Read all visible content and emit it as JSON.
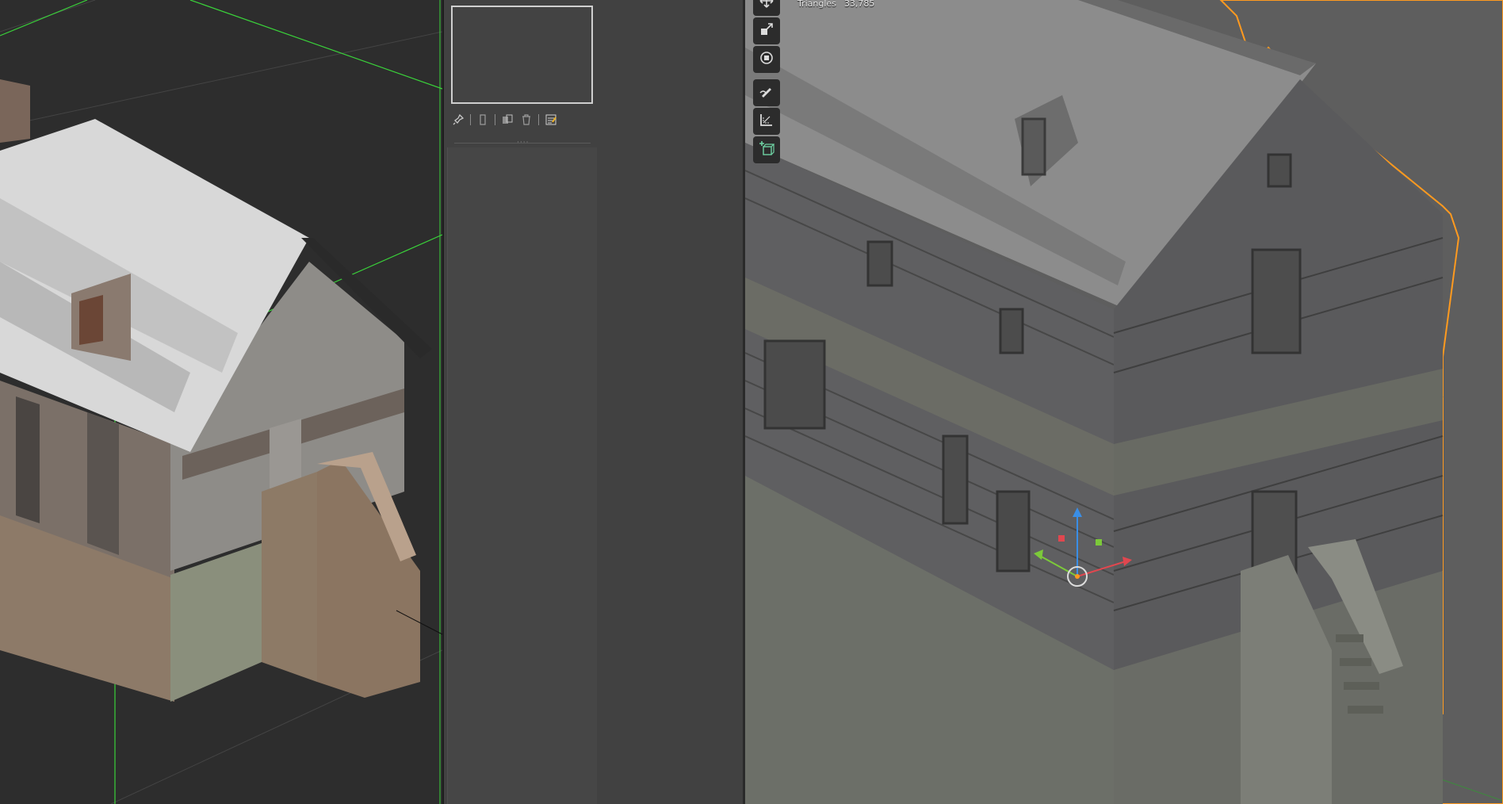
{
  "right_viewport": {
    "stats": {
      "label": "Triangles",
      "value": "33,785"
    }
  },
  "tools": [
    {
      "name": "move-tool",
      "icon": "move-icon"
    },
    {
      "name": "scale-tool",
      "icon": "scale-icon"
    },
    {
      "name": "transform-tool",
      "icon": "transform-icon"
    },
    {
      "name": "annotate-tool",
      "icon": "annotate-pencil-icon"
    },
    {
      "name": "measure-tool",
      "icon": "ruler-icon"
    },
    {
      "name": "add-cube-tool",
      "icon": "add-cube-icon"
    }
  ],
  "colors": {
    "selection_outline": "#ff9a1f",
    "grid_line": "#3ad33a",
    "gizmo_x": "#e0474f",
    "gizmo_y": "#7cc93a",
    "gizmo_z": "#3a8ee6"
  }
}
